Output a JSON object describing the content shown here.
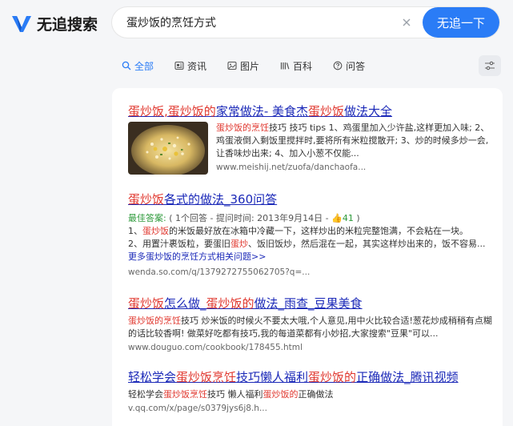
{
  "header": {
    "logo_text": "无追搜索",
    "search_value": "蛋炒饭的烹饪方式",
    "search_button": "无追一下"
  },
  "tabs": [
    {
      "label": "全部",
      "active": true,
      "icon": "search-icon"
    },
    {
      "label": "资讯",
      "active": false,
      "icon": "news-icon"
    },
    {
      "label": "图片",
      "active": false,
      "icon": "image-icon"
    },
    {
      "label": "百科",
      "active": false,
      "icon": "encyclopedia-icon"
    },
    {
      "label": "问答",
      "active": false,
      "icon": "question-icon"
    }
  ],
  "colors": {
    "accent": "#2a7cf6",
    "link": "#1b29b8",
    "highlight": "#e0362d",
    "green": "#2e9a3b"
  },
  "results": [
    {
      "title_parts": [
        "蛋炒饭",
        ",",
        "蛋炒饭的",
        "家常做法- 美食杰",
        "蛋炒饭",
        "做法大全"
      ],
      "snippet_parts": [
        "蛋炒饭的烹饪",
        "技巧 技巧 tips 1、鸡蛋里加入少许盐,这样更加入味; 2、鸡蛋液倒入剩饭里搅拌时,要将所有米粒搅散开; 3、炒的时候多炒一会,让香味炒出来; 4、加入小葱不仅能..."
      ],
      "url": "www.meishij.net/zuofa/danchaofa..."
    },
    {
      "title_parts": [
        "蛋炒饭",
        "各式的做法_360问答"
      ],
      "best_answer": "最佳答案:",
      "meta": "( 1个回答 - 提问时间: 2013年9月14日 - ",
      "likes": "41",
      "meta_end": " )",
      "line1_parts": [
        "1、",
        "蛋炒饭",
        "的米饭最好放在冰箱中冷藏一下，这样炒出的米粒完整饱满，不会粘在一块。"
      ],
      "line2_parts": [
        "2、用置汁裹饭粒，要蛋旧",
        "蛋炒",
        "、饭旧饭炒，然后混在一起，其实这样炒出来的，饭不容易..."
      ],
      "more": "更多蛋炒饭的烹饪方式相关问题>>",
      "url": "wenda.so.com/q/1379272755062705?q=..."
    },
    {
      "title_parts": [
        "蛋炒饭",
        "怎么做_",
        "蛋炒饭的",
        "做法_雨查_豆果美食"
      ],
      "snippet_parts": [
        "蛋炒饭的烹饪",
        "技巧 炒米饭的时候火不要太大哦,个人意见,用中火比较合适!葱花炒成稍稍有点糊的话比较香啊! 做菜好吃都有技巧,我的每道菜都有小妙招,大家搜索\"豆果\"可以..."
      ],
      "url": "www.douguo.com/cookbook/178455.html"
    },
    {
      "title_parts": [
        "轻松学会",
        "蛋炒饭烹饪",
        "技巧懒人福利",
        "蛋炒饭的",
        "正确做法_腾讯视频"
      ],
      "snippet_parts": [
        "轻松学会",
        "蛋炒饭烹饪",
        "技巧 懒人福利",
        "蛋炒饭的",
        "正确做法"
      ],
      "url": "v.qq.com/x/page/s0379jys6j8.h..."
    }
  ]
}
